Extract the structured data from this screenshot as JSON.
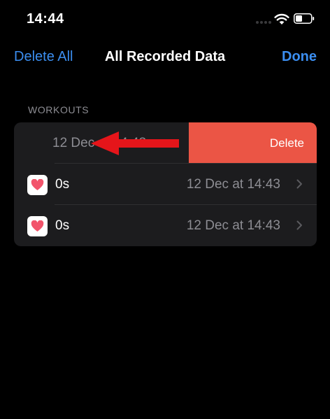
{
  "status_bar": {
    "time": "14:44",
    "icons": [
      "cellular-signal-icon",
      "wifi-icon",
      "battery-icon"
    ]
  },
  "nav": {
    "left_button": "Delete All",
    "title": "All Recorded Data",
    "right_button": "Done"
  },
  "section": {
    "header": "WORKOUTS"
  },
  "swiped_row": {
    "date": "12 Dec at 14:43",
    "delete_label": "Delete"
  },
  "rows": [
    {
      "icon": "heart-icon",
      "duration": "0s",
      "date": "12 Dec at 14:43"
    },
    {
      "icon": "heart-icon",
      "duration": "0s",
      "date": "12 Dec at 14:43"
    }
  ],
  "colors": {
    "accent": "#3b8ef0",
    "delete": "#eb5545",
    "annotation_arrow": "#e5151a",
    "heart": "#f2546b"
  }
}
